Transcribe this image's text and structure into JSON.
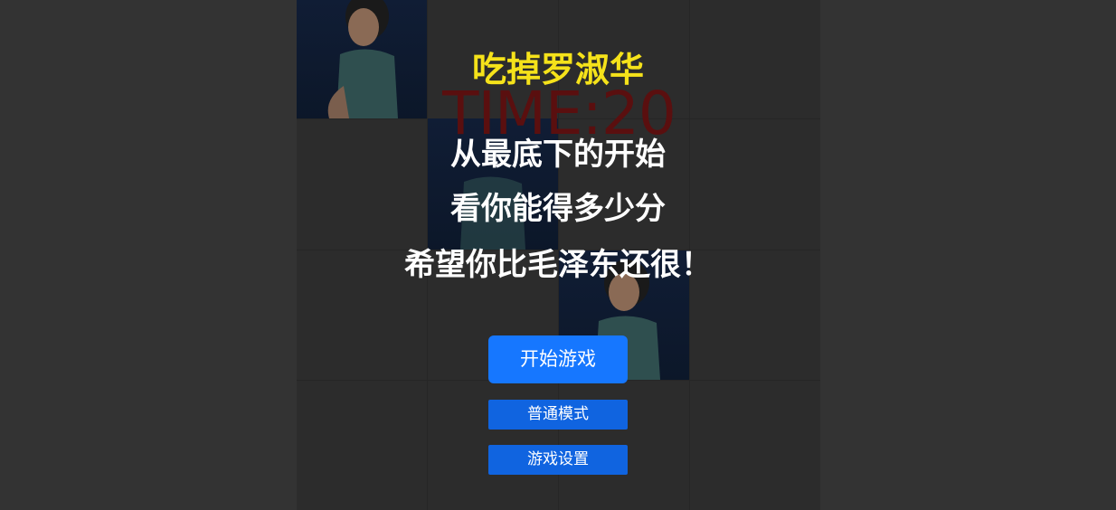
{
  "game": {
    "title": "吃掉罗淑华",
    "timer": "TIME:20",
    "instructions": {
      "line1": "从最底下的开始",
      "line2": "看你能得多少分",
      "line3": "希望你比毛泽东还很！"
    },
    "buttons": {
      "start": "开始游戏",
      "mode": "普通模式",
      "settings": "游戏设置"
    },
    "colors": {
      "background": "#333333",
      "title": "#f5e21a",
      "timer": "#5a0f0f",
      "button": "#1677ff",
      "tile": "#0f1b33"
    }
  }
}
